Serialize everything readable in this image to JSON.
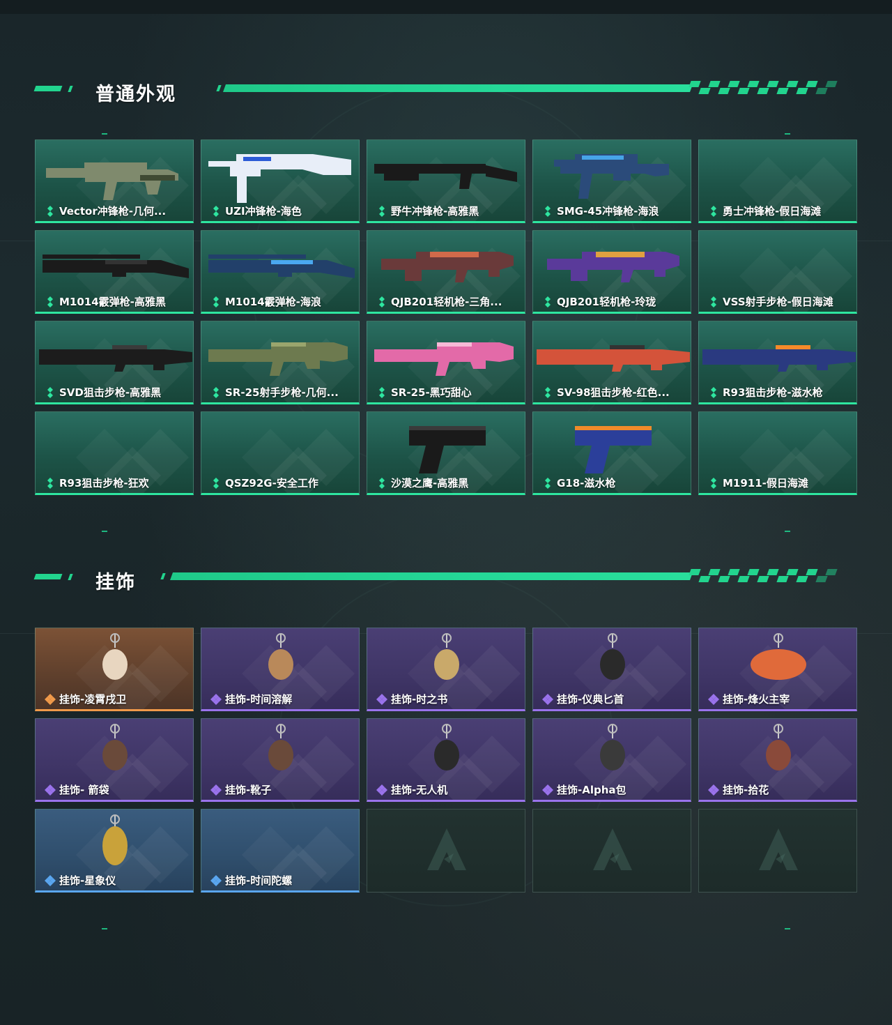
{
  "sections": [
    {
      "title": "普通外观",
      "items": [
        {
          "label": "Vector冲锋枪-几何...",
          "rarity": "green",
          "icon": "smg-vector-icon"
        },
        {
          "label": "UZI冲锋枪-海色",
          "rarity": "green",
          "icon": "smg-uzi-icon"
        },
        {
          "label": "野牛冲锋枪-高雅黑",
          "rarity": "green",
          "icon": "smg-bizon-icon"
        },
        {
          "label": "SMG-45冲锋枪-海浪",
          "rarity": "green",
          "icon": "smg-45-icon"
        },
        {
          "label": "勇士冲锋枪-假日海滩",
          "rarity": "green",
          "icon": ""
        },
        {
          "label": "M1014霰弹枪-高雅黑",
          "rarity": "green",
          "icon": "shotgun-icon"
        },
        {
          "label": "M1014霰弹枪-海浪",
          "rarity": "green",
          "icon": "shotgun-icon"
        },
        {
          "label": "QJB201轻机枪-三角...",
          "rarity": "green",
          "icon": "lmg-icon"
        },
        {
          "label": "QJB201轻机枪-玲珑",
          "rarity": "green",
          "icon": "lmg-icon"
        },
        {
          "label": "VSS射手步枪-假日海滩",
          "rarity": "green",
          "icon": ""
        },
        {
          "label": "SVD狙击步枪-高雅黑",
          "rarity": "green",
          "icon": "sniper-icon"
        },
        {
          "label": "SR-25射手步枪-几何...",
          "rarity": "green",
          "icon": "dmr-icon"
        },
        {
          "label": "SR-25-黑巧甜心",
          "rarity": "green",
          "icon": "dmr-icon"
        },
        {
          "label": "SV-98狙击步枪-红色...",
          "rarity": "green",
          "icon": "sniper-icon"
        },
        {
          "label": "R93狙击步枪-滋水枪",
          "rarity": "green",
          "icon": "sniper-icon"
        },
        {
          "label": "R93狙击步枪-狂欢",
          "rarity": "green",
          "icon": ""
        },
        {
          "label": "QSZ92G-安全工作",
          "rarity": "green",
          "icon": ""
        },
        {
          "label": "沙漠之鹰-高雅黑",
          "rarity": "green",
          "icon": "pistol-icon"
        },
        {
          "label": "G18-滋水枪",
          "rarity": "green",
          "icon": "pistol-icon"
        },
        {
          "label": "M1911-假日海滩",
          "rarity": "green",
          "icon": ""
        }
      ]
    },
    {
      "title": "挂饰",
      "items": [
        {
          "label": "挂饰-凌霄戌卫",
          "rarity": "gold",
          "icon": "charm-icon"
        },
        {
          "label": "挂饰-时间溶解",
          "rarity": "purple",
          "icon": "charm-icon"
        },
        {
          "label": "挂饰-时之书",
          "rarity": "purple",
          "icon": "charm-icon"
        },
        {
          "label": "挂饰-仪典匕首",
          "rarity": "purple",
          "icon": "charm-icon"
        },
        {
          "label": "挂饰-烽火主宰",
          "rarity": "purple",
          "icon": "charm-icon"
        },
        {
          "label": "挂饰- 箭袋",
          "rarity": "purple",
          "icon": "charm-icon"
        },
        {
          "label": "挂饰-靴子",
          "rarity": "purple",
          "icon": "charm-icon"
        },
        {
          "label": "挂饰-无人机",
          "rarity": "purple",
          "icon": "charm-icon"
        },
        {
          "label": "挂饰-Alpha包",
          "rarity": "purple",
          "icon": "charm-icon"
        },
        {
          "label": "挂饰-拾花",
          "rarity": "purple",
          "icon": "charm-icon"
        },
        {
          "label": "挂饰-星象仪",
          "rarity": "blue",
          "icon": "charm-icon"
        },
        {
          "label": "挂饰-时间陀螺",
          "rarity": "blue",
          "icon": ""
        },
        {
          "label": "",
          "rarity": "empty",
          "icon": "empty-slot-logo-icon"
        },
        {
          "label": "",
          "rarity": "empty",
          "icon": "empty-slot-logo-icon"
        },
        {
          "label": "",
          "rarity": "empty",
          "icon": "empty-slot-logo-icon"
        }
      ]
    }
  ],
  "colors": {
    "accent": "#22d48e",
    "green": "#2ee6a0",
    "purple": "#9a73ec",
    "gold": "#f19a4a",
    "blue": "#5aa6ef"
  }
}
